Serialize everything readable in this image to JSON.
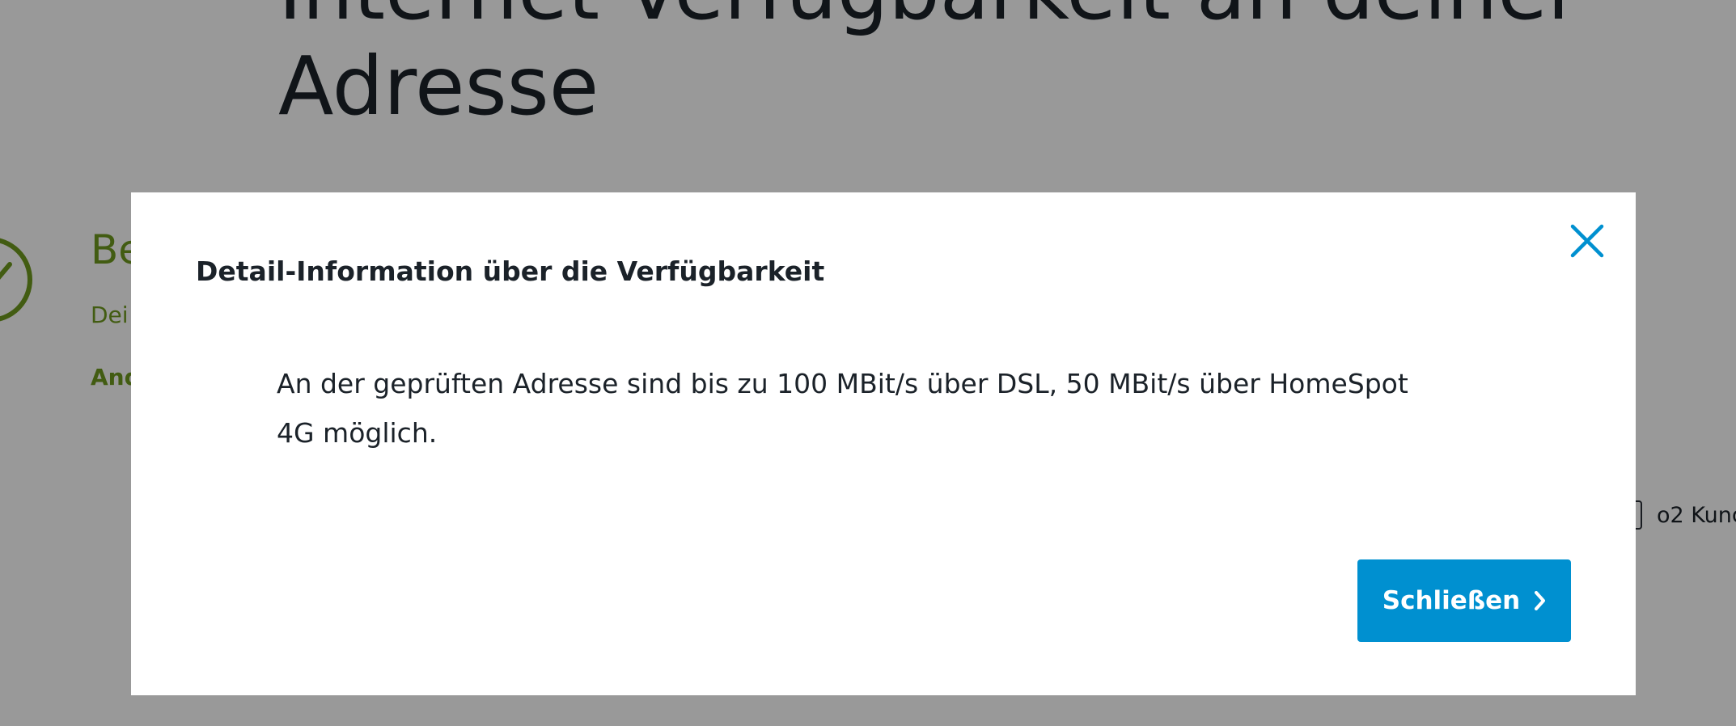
{
  "page": {
    "headline_line1": "Internet Verfügbarkeit an deiner",
    "headline_line2": "Adresse",
    "status_title": "Be",
    "status_sub": "Dei",
    "status_link": "And",
    "customer_check_label": "o2 Kund"
  },
  "modal": {
    "title": "Detail-Information über die Verfügbarkeit",
    "text": "An der geprüften Adresse sind bis zu 100 MBit/s über DSL, 50 MBit/s über HomeSpot 4G möglich.",
    "close_button_label": "Schließen",
    "icons": {
      "close": "close-icon",
      "chevron": "chevron-right-icon"
    }
  },
  "colors": {
    "overlay": "rgba(0,0,0,0.40)",
    "primary_button": "#0090d0",
    "close_icon": "#0090d0",
    "success": "#6f9a1e",
    "text": "#1b2229"
  }
}
